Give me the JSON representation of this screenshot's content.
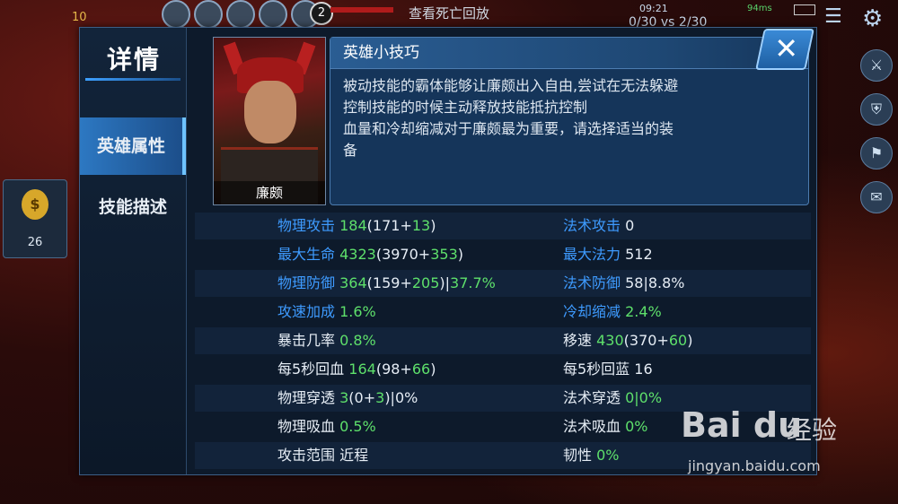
{
  "hud": {
    "level_badge": "10",
    "skill_level": "2",
    "death_replay": "查看死亡回放",
    "clock": "09:21",
    "score": "0/30 vs 2/30",
    "ping": "94ms",
    "gold": "26"
  },
  "panel": {
    "title": "详情",
    "tabs": [
      {
        "label": "英雄属性",
        "active": true
      },
      {
        "label": "技能描述",
        "active": false
      }
    ],
    "hero_name": "廉颇",
    "tips": {
      "title": "英雄小技巧",
      "lines": [
        "被动技能的霸体能够让廉颇出入自由,尝试在无法躲避",
        "控制技能的时候主动释放技能抵抗控制",
        "血量和冷却缩减对于廉颇最为重要，请选择适当的装",
        "备"
      ]
    },
    "close_icon": "close-icon",
    "stats": [
      {
        "left": {
          "label": "物理攻击",
          "parts": [
            "184",
            "(171+",
            "13",
            ")"
          ]
        },
        "right": {
          "label": "法术攻击",
          "parts": [
            "0"
          ]
        }
      },
      {
        "left": {
          "label": "最大生命",
          "parts": [
            "4323",
            "(3970+",
            "353",
            ")"
          ]
        },
        "right": {
          "label": "最大法力",
          "parts": [
            "512"
          ]
        }
      },
      {
        "left": {
          "label": "物理防御",
          "parts": [
            "364",
            "(159+",
            "205",
            ")|",
            "37.7%"
          ]
        },
        "right": {
          "label": "法术防御",
          "parts": [
            "58|8.8%"
          ]
        }
      },
      {
        "left": {
          "label": "攻速加成",
          "parts": [
            "1.6%"
          ]
        },
        "right": {
          "label": "冷却缩减",
          "parts": [
            "2.4%"
          ]
        }
      },
      {
        "left": {
          "label": "暴击几率",
          "parts": [
            "0.8%"
          ]
        },
        "right": {
          "label": "移速",
          "parts": [
            "430",
            "(370+",
            "60",
            ")"
          ]
        }
      },
      {
        "left": {
          "label": "每5秒回血",
          "parts": [
            "164",
            "(98+",
            "66",
            ")"
          ]
        },
        "right": {
          "label": "每5秒回蓝",
          "parts": [
            "16"
          ]
        }
      },
      {
        "left": {
          "label": "物理穿透",
          "parts": [
            "3",
            "(0+",
            "3",
            ")|0%"
          ]
        },
        "right": {
          "label": "法术穿透",
          "parts": [
            "0|0%"
          ]
        }
      },
      {
        "left": {
          "label": "物理吸血",
          "parts": [
            "0.5%"
          ]
        },
        "right": {
          "label": "法术吸血",
          "parts": [
            "0%"
          ]
        }
      },
      {
        "left": {
          "label": "攻击范围",
          "parts": [
            "近程"
          ]
        },
        "right": {
          "label": "韧性",
          "parts": [
            "0%"
          ]
        }
      }
    ]
  },
  "watermark": {
    "logo": "Bai du",
    "cn": "经验",
    "url": "jingyan.baidu.com"
  },
  "colors": {
    "accent_blue": "#3e9bff",
    "bonus_green": "#5ee06b",
    "panel_bg": "#0d1a2b"
  }
}
